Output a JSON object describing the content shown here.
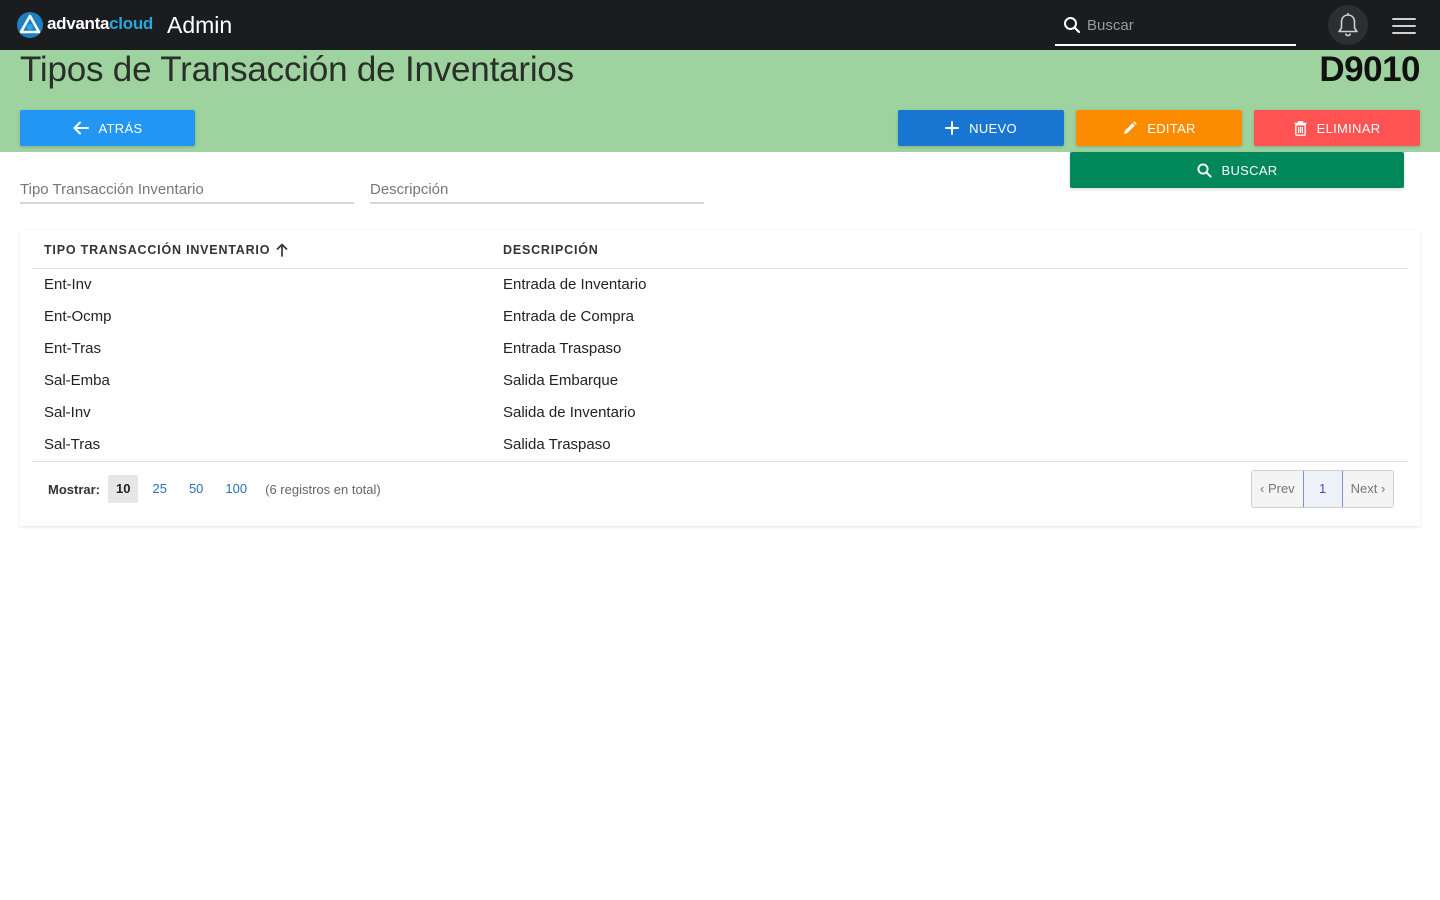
{
  "topbar": {
    "brand_part1": "advanta",
    "brand_part2": "cloud",
    "section": "Admin",
    "search_placeholder": "Buscar"
  },
  "header": {
    "title": "Tipos de Transacción de Inventarios",
    "code": "D9010"
  },
  "actions": {
    "back_label": "ATRÁS",
    "new_label": "NUEVO",
    "edit_label": "EDITAR",
    "delete_label": "ELIMINAR",
    "search_label": "BUSCAR"
  },
  "filters": {
    "tipo_placeholder": "Tipo Transacción Inventario",
    "descripcion_placeholder": "Descripción"
  },
  "table": {
    "columns": [
      "TIPO TRANSACCIÓN INVENTARIO",
      "DESCRIPCIÓN"
    ],
    "rows": [
      [
        "Ent-Inv",
        "Entrada de Inventario"
      ],
      [
        "Ent-Ocmp",
        "Entrada de Compra"
      ],
      [
        "Ent-Tras",
        "Entrada Traspaso"
      ],
      [
        "Sal-Emba",
        "Salida Embarque"
      ],
      [
        "Sal-Inv",
        "Salida de Inventario"
      ],
      [
        "Sal-Tras",
        "Salida Traspaso"
      ]
    ]
  },
  "pagination": {
    "show_label": "Mostrar:",
    "sizes": [
      "10",
      "25",
      "50",
      "100"
    ],
    "total_text": "(6 registros en total)",
    "prev": "‹ Prev",
    "page": "1",
    "next": "Next ›"
  },
  "colors": {
    "topbar": "#1b1c1e",
    "header": "#9ed39f",
    "back": "#2196f3",
    "new": "#1976d2",
    "edit": "#fb8c00",
    "delete": "#ff5252",
    "search": "#00875a"
  },
  "icons": [
    "logo-icon",
    "search-icon",
    "bell-icon",
    "hamburger-icon",
    "arrow-left-icon",
    "plus-icon",
    "pencil-icon",
    "trash-icon",
    "sort-ascending-icon"
  ]
}
